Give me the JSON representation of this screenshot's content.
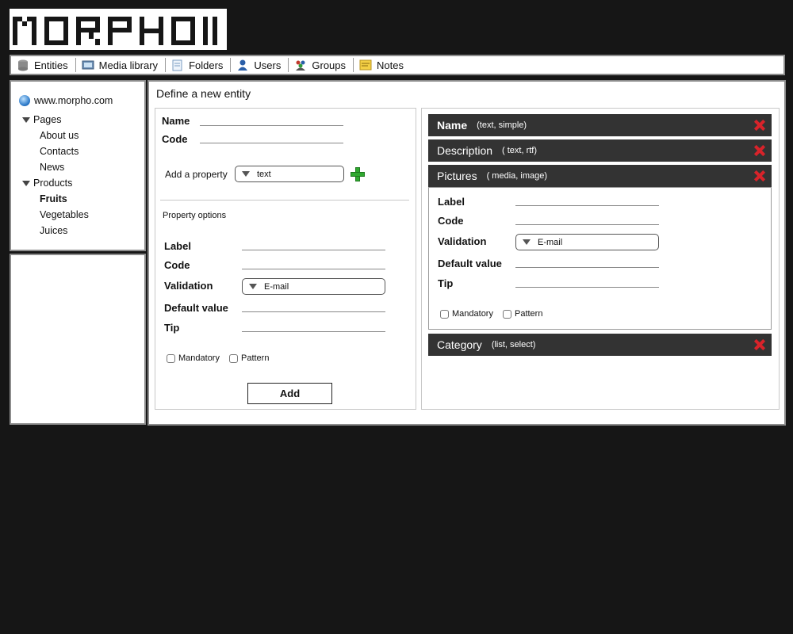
{
  "logo": {
    "text": "MORPHO"
  },
  "nav": {
    "items": [
      {
        "label": "Entities",
        "icon": "database-icon"
      },
      {
        "label": "Media library",
        "icon": "media-icon"
      },
      {
        "label": "Folders",
        "icon": "folder-icon"
      },
      {
        "label": "Users",
        "icon": "user-icon"
      },
      {
        "label": "Groups",
        "icon": "group-icon"
      },
      {
        "label": "Notes",
        "icon": "notes-icon"
      }
    ]
  },
  "sidebar": {
    "site": "www.morpho.com",
    "pages_label": "Pages",
    "pages": [
      "About us",
      "Contacts",
      "News"
    ],
    "products_label": "Products",
    "products": [
      "Fruits",
      "Vegetables",
      "Juices"
    ],
    "selected": "Fruits"
  },
  "main": {
    "title": "Define a new entity",
    "form": {
      "name_label": "Name",
      "code_label": "Code",
      "add_property_label": "Add a property",
      "add_property_value": "text",
      "property_options_label": "Property options",
      "label_label": "Label",
      "code2_label": "Code",
      "validation_label": "Validation",
      "validation_value": "E-mail",
      "default_value_label": "Default value",
      "tip_label": "Tip",
      "mandatory_label": "Mandatory",
      "pattern_label": "Pattern",
      "add_button": "Add"
    },
    "properties": [
      {
        "name": "Name",
        "type": "(text, simple)"
      },
      {
        "name": "Description",
        "type": "( text, rtf)"
      },
      {
        "name": "Pictures",
        "type": "( media, image)"
      },
      {
        "name": "Category",
        "type": "(list, select)"
      }
    ],
    "expanded": {
      "label_label": "Label",
      "code_label": "Code",
      "validation_label": "Validation",
      "validation_value": "E-mail",
      "default_value_label": "Default value",
      "tip_label": "Tip",
      "mandatory_label": "Mandatory",
      "pattern_label": "Pattern"
    }
  },
  "colors": {
    "background": "#161616",
    "header_bar": "#333333",
    "delete": "#d8232a",
    "add": "#2fa82f"
  }
}
